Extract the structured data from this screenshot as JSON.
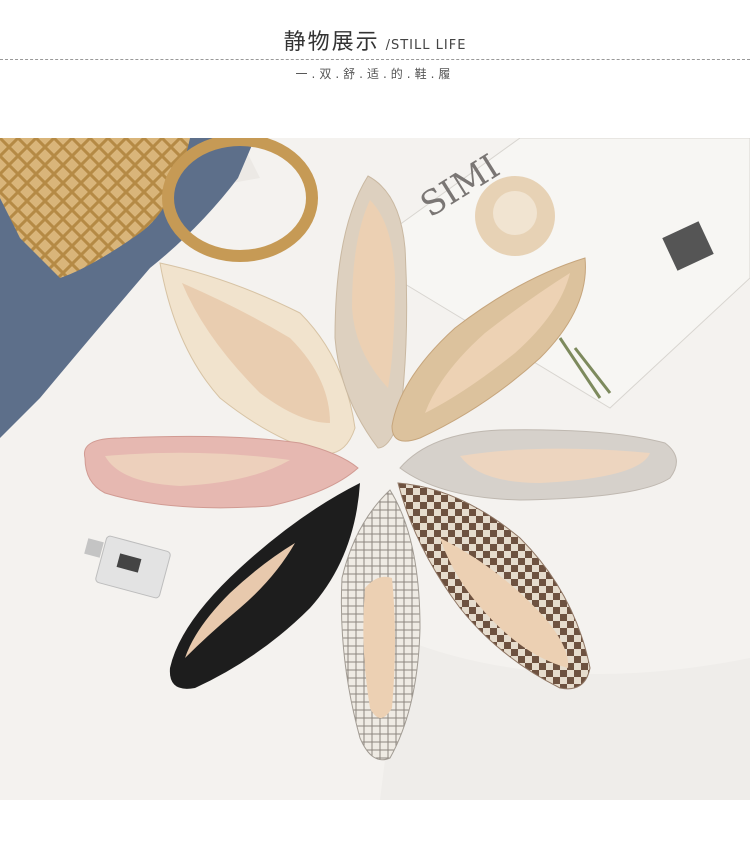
{
  "header": {
    "title_cn": "静物展示",
    "title_en": "/STILL LIFE",
    "subtitle": "一.双.舒.适.的.鞋.履"
  },
  "photo": {
    "magazine_text": "SIMI"
  }
}
